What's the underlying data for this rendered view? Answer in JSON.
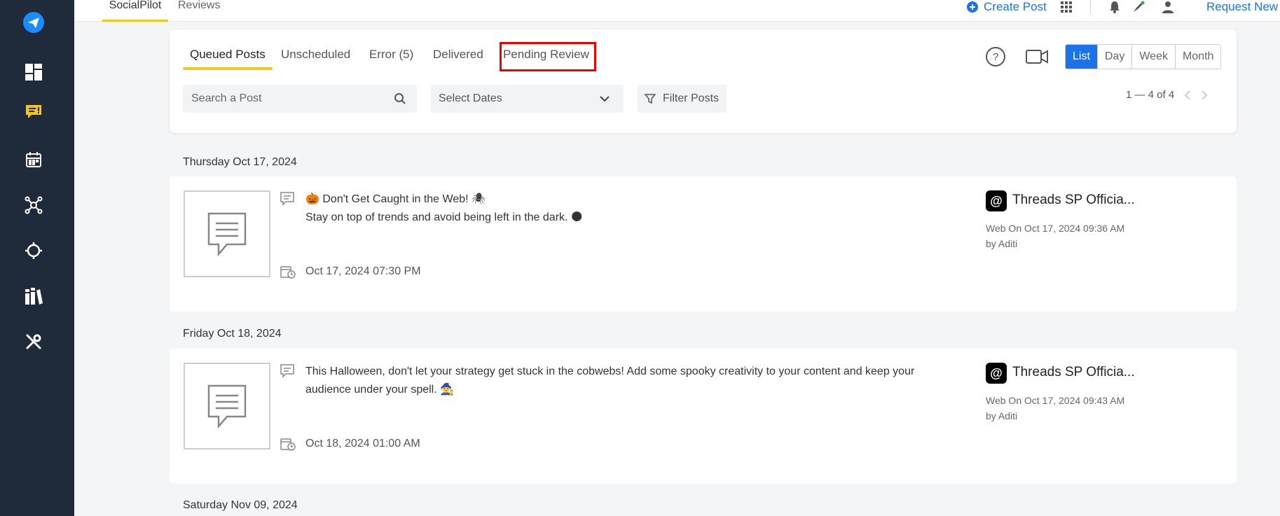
{
  "topbar": {
    "tabs": [
      {
        "label": "SocialPilot"
      },
      {
        "label": "Reviews"
      }
    ],
    "create_post": "Create Post",
    "request_link": "Request New F"
  },
  "post_tabs": [
    {
      "label": "Queued Posts"
    },
    {
      "label": "Unscheduled"
    },
    {
      "label": "Error (5)"
    },
    {
      "label": "Delivered"
    },
    {
      "label": "Pending Review"
    }
  ],
  "filters": {
    "search_placeholder": "Search a Post",
    "dates_label": "Select Dates",
    "filter_label": "Filter Posts"
  },
  "views": [
    "List",
    "Day",
    "Week",
    "Month"
  ],
  "pager": "1 — 4 of 4",
  "groups": [
    {
      "date": "Thursday Oct 17, 2024",
      "post": {
        "lines": [
          "🎃 Don't Get Caught in the Web! 🕷",
          "Stay on top of trends and avoid being left in the dark. 🌑"
        ],
        "schedule": "Oct 17, 2024 07:30 PM",
        "account": "Threads SP Officia...",
        "meta": "Web On Oct 17, 2024 09:36 AM",
        "by": "by Aditi"
      }
    },
    {
      "date": "Friday Oct 18, 2024",
      "post": {
        "lines": [
          "This Halloween, don't let your strategy get stuck in the cobwebs! Add some spooky creativity to your content and keep your",
          "audience under your spell. 🧙"
        ],
        "schedule": "Oct 18, 2024 01:00 AM",
        "account": "Threads SP Officia...",
        "meta": "Web On Oct 17, 2024 09:43 AM",
        "by": "by Aditi"
      }
    },
    {
      "date": "Saturday Nov 09, 2024"
    }
  ],
  "colors": {
    "accent": "#1a73e8",
    "sidebar": "#1f2a3b",
    "highlight": "#f5c518",
    "annotation": "#ee0000"
  }
}
